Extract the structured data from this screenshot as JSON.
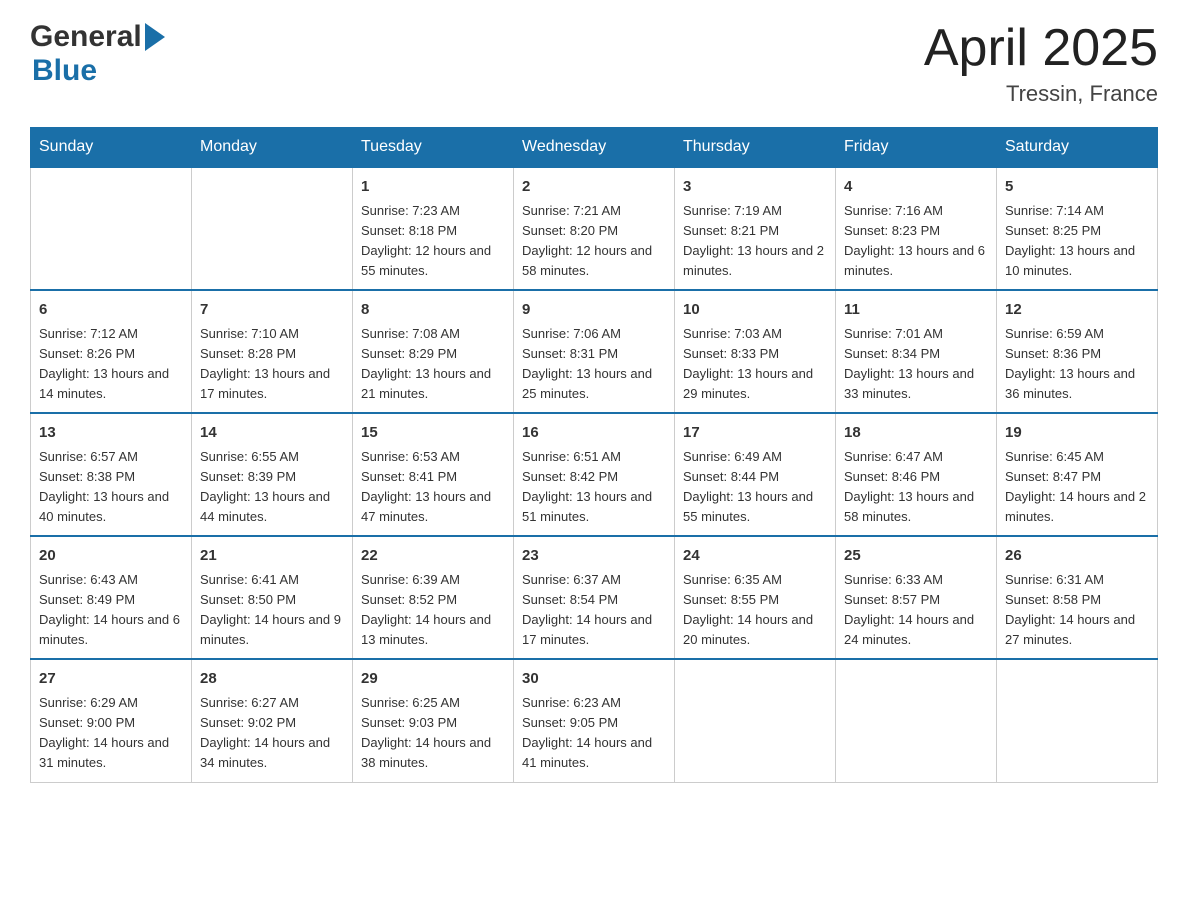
{
  "header": {
    "title": "April 2025",
    "subtitle": "Tressin, France",
    "logo_general": "General",
    "logo_blue": "Blue"
  },
  "days_of_week": [
    "Sunday",
    "Monday",
    "Tuesday",
    "Wednesday",
    "Thursday",
    "Friday",
    "Saturday"
  ],
  "weeks": [
    [
      {
        "day": "",
        "info": ""
      },
      {
        "day": "",
        "info": ""
      },
      {
        "day": "1",
        "info": "Sunrise: 7:23 AM\nSunset: 8:18 PM\nDaylight: 12 hours\nand 55 minutes."
      },
      {
        "day": "2",
        "info": "Sunrise: 7:21 AM\nSunset: 8:20 PM\nDaylight: 12 hours\nand 58 minutes."
      },
      {
        "day": "3",
        "info": "Sunrise: 7:19 AM\nSunset: 8:21 PM\nDaylight: 13 hours\nand 2 minutes."
      },
      {
        "day": "4",
        "info": "Sunrise: 7:16 AM\nSunset: 8:23 PM\nDaylight: 13 hours\nand 6 minutes."
      },
      {
        "day": "5",
        "info": "Sunrise: 7:14 AM\nSunset: 8:25 PM\nDaylight: 13 hours\nand 10 minutes."
      }
    ],
    [
      {
        "day": "6",
        "info": "Sunrise: 7:12 AM\nSunset: 8:26 PM\nDaylight: 13 hours\nand 14 minutes."
      },
      {
        "day": "7",
        "info": "Sunrise: 7:10 AM\nSunset: 8:28 PM\nDaylight: 13 hours\nand 17 minutes."
      },
      {
        "day": "8",
        "info": "Sunrise: 7:08 AM\nSunset: 8:29 PM\nDaylight: 13 hours\nand 21 minutes."
      },
      {
        "day": "9",
        "info": "Sunrise: 7:06 AM\nSunset: 8:31 PM\nDaylight: 13 hours\nand 25 minutes."
      },
      {
        "day": "10",
        "info": "Sunrise: 7:03 AM\nSunset: 8:33 PM\nDaylight: 13 hours\nand 29 minutes."
      },
      {
        "day": "11",
        "info": "Sunrise: 7:01 AM\nSunset: 8:34 PM\nDaylight: 13 hours\nand 33 minutes."
      },
      {
        "day": "12",
        "info": "Sunrise: 6:59 AM\nSunset: 8:36 PM\nDaylight: 13 hours\nand 36 minutes."
      }
    ],
    [
      {
        "day": "13",
        "info": "Sunrise: 6:57 AM\nSunset: 8:38 PM\nDaylight: 13 hours\nand 40 minutes."
      },
      {
        "day": "14",
        "info": "Sunrise: 6:55 AM\nSunset: 8:39 PM\nDaylight: 13 hours\nand 44 minutes."
      },
      {
        "day": "15",
        "info": "Sunrise: 6:53 AM\nSunset: 8:41 PM\nDaylight: 13 hours\nand 47 minutes."
      },
      {
        "day": "16",
        "info": "Sunrise: 6:51 AM\nSunset: 8:42 PM\nDaylight: 13 hours\nand 51 minutes."
      },
      {
        "day": "17",
        "info": "Sunrise: 6:49 AM\nSunset: 8:44 PM\nDaylight: 13 hours\nand 55 minutes."
      },
      {
        "day": "18",
        "info": "Sunrise: 6:47 AM\nSunset: 8:46 PM\nDaylight: 13 hours\nand 58 minutes."
      },
      {
        "day": "19",
        "info": "Sunrise: 6:45 AM\nSunset: 8:47 PM\nDaylight: 14 hours\nand 2 minutes."
      }
    ],
    [
      {
        "day": "20",
        "info": "Sunrise: 6:43 AM\nSunset: 8:49 PM\nDaylight: 14 hours\nand 6 minutes."
      },
      {
        "day": "21",
        "info": "Sunrise: 6:41 AM\nSunset: 8:50 PM\nDaylight: 14 hours\nand 9 minutes."
      },
      {
        "day": "22",
        "info": "Sunrise: 6:39 AM\nSunset: 8:52 PM\nDaylight: 14 hours\nand 13 minutes."
      },
      {
        "day": "23",
        "info": "Sunrise: 6:37 AM\nSunset: 8:54 PM\nDaylight: 14 hours\nand 17 minutes."
      },
      {
        "day": "24",
        "info": "Sunrise: 6:35 AM\nSunset: 8:55 PM\nDaylight: 14 hours\nand 20 minutes."
      },
      {
        "day": "25",
        "info": "Sunrise: 6:33 AM\nSunset: 8:57 PM\nDaylight: 14 hours\nand 24 minutes."
      },
      {
        "day": "26",
        "info": "Sunrise: 6:31 AM\nSunset: 8:58 PM\nDaylight: 14 hours\nand 27 minutes."
      }
    ],
    [
      {
        "day": "27",
        "info": "Sunrise: 6:29 AM\nSunset: 9:00 PM\nDaylight: 14 hours\nand 31 minutes."
      },
      {
        "day": "28",
        "info": "Sunrise: 6:27 AM\nSunset: 9:02 PM\nDaylight: 14 hours\nand 34 minutes."
      },
      {
        "day": "29",
        "info": "Sunrise: 6:25 AM\nSunset: 9:03 PM\nDaylight: 14 hours\nand 38 minutes."
      },
      {
        "day": "30",
        "info": "Sunrise: 6:23 AM\nSunset: 9:05 PM\nDaylight: 14 hours\nand 41 minutes."
      },
      {
        "day": "",
        "info": ""
      },
      {
        "day": "",
        "info": ""
      },
      {
        "day": "",
        "info": ""
      }
    ]
  ]
}
